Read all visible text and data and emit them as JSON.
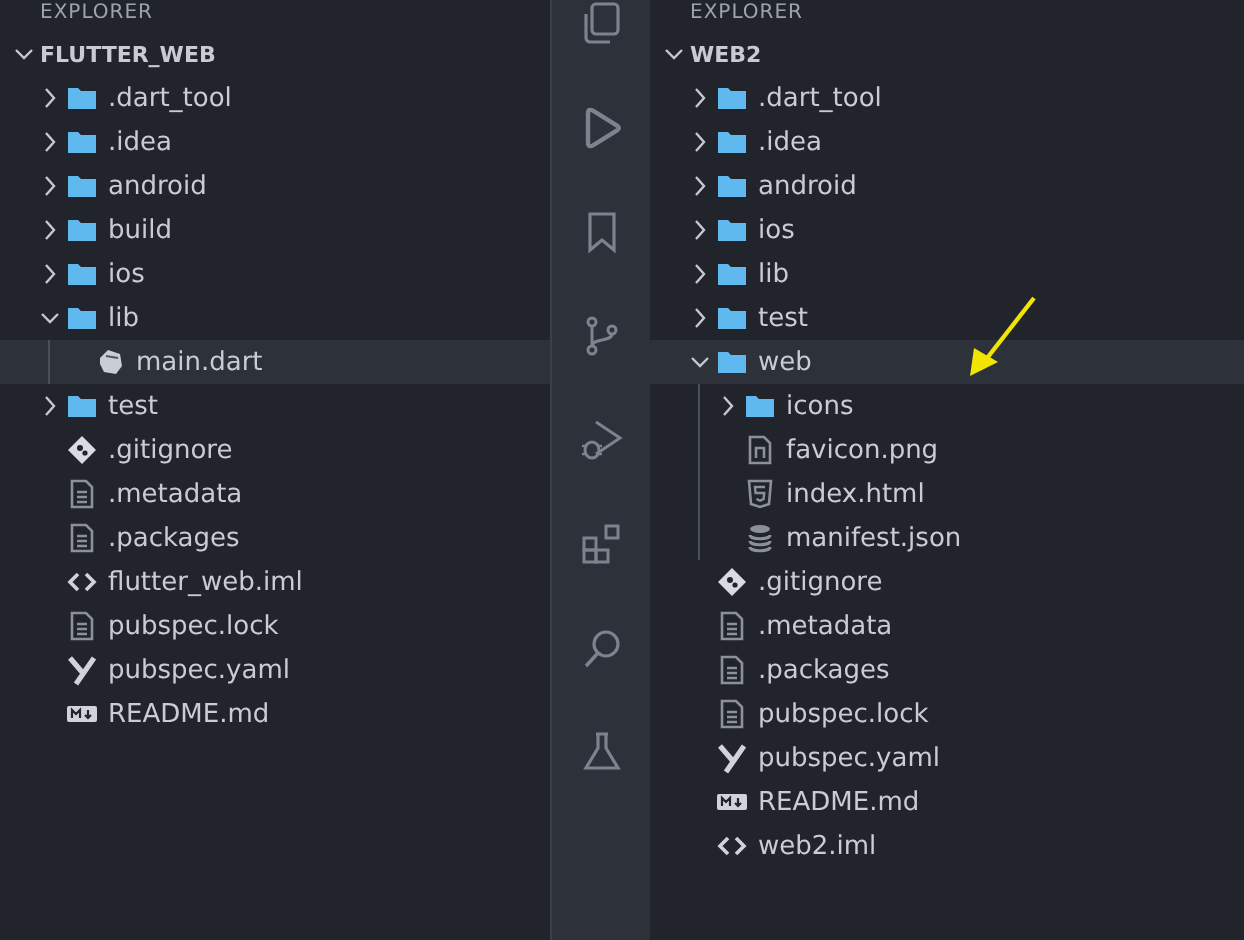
{
  "panes": [
    {
      "header": "EXPLORER",
      "root": {
        "label": "FLUTTER_WEB",
        "expanded": true
      },
      "items": [
        {
          "name": ".dart_tool",
          "kind": "folder",
          "expanded": false,
          "selected": false
        },
        {
          "name": ".idea",
          "kind": "folder",
          "expanded": false,
          "selected": false
        },
        {
          "name": "android",
          "kind": "folder",
          "expanded": false,
          "selected": false
        },
        {
          "name": "build",
          "kind": "folder",
          "expanded": false,
          "selected": false
        },
        {
          "name": "ios",
          "kind": "folder",
          "expanded": false,
          "selected": false
        },
        {
          "name": "lib",
          "kind": "folder",
          "expanded": true,
          "selected": false,
          "children": [
            {
              "name": "main.dart",
              "kind": "dart",
              "selected": true
            }
          ]
        },
        {
          "name": "test",
          "kind": "folder",
          "expanded": false,
          "selected": false
        },
        {
          "name": ".gitignore",
          "kind": "git",
          "selected": false
        },
        {
          "name": ".metadata",
          "kind": "doc",
          "selected": false
        },
        {
          "name": ".packages",
          "kind": "doc",
          "selected": false
        },
        {
          "name": "flutter_web.iml",
          "kind": "code",
          "selected": false
        },
        {
          "name": "pubspec.lock",
          "kind": "doc",
          "selected": false
        },
        {
          "name": "pubspec.yaml",
          "kind": "yaml",
          "selected": false
        },
        {
          "name": "README.md",
          "kind": "markdown",
          "selected": false
        }
      ]
    },
    {
      "header": "EXPLORER",
      "root": {
        "label": "WEB2",
        "expanded": true
      },
      "items": [
        {
          "name": ".dart_tool",
          "kind": "folder",
          "expanded": false,
          "selected": false
        },
        {
          "name": ".idea",
          "kind": "folder",
          "expanded": false,
          "selected": false
        },
        {
          "name": "android",
          "kind": "folder",
          "expanded": false,
          "selected": false
        },
        {
          "name": "ios",
          "kind": "folder",
          "expanded": false,
          "selected": false
        },
        {
          "name": "lib",
          "kind": "folder",
          "expanded": false,
          "selected": false
        },
        {
          "name": "test",
          "kind": "folder",
          "expanded": false,
          "selected": false
        },
        {
          "name": "web",
          "kind": "folder",
          "expanded": true,
          "selected": true,
          "children": [
            {
              "name": "icons",
              "kind": "folder",
              "expanded": false,
              "selected": false
            },
            {
              "name": "favicon.png",
              "kind": "image",
              "selected": false
            },
            {
              "name": "index.html",
              "kind": "html",
              "selected": false
            },
            {
              "name": "manifest.json",
              "kind": "database",
              "selected": false
            }
          ]
        },
        {
          "name": ".gitignore",
          "kind": "git",
          "selected": false
        },
        {
          "name": ".metadata",
          "kind": "doc",
          "selected": false
        },
        {
          "name": ".packages",
          "kind": "doc",
          "selected": false
        },
        {
          "name": "pubspec.lock",
          "kind": "doc",
          "selected": false
        },
        {
          "name": "pubspec.yaml",
          "kind": "yaml",
          "selected": false
        },
        {
          "name": "README.md",
          "kind": "markdown",
          "selected": false
        },
        {
          "name": "web2.iml",
          "kind": "code",
          "selected": false
        }
      ]
    }
  ]
}
